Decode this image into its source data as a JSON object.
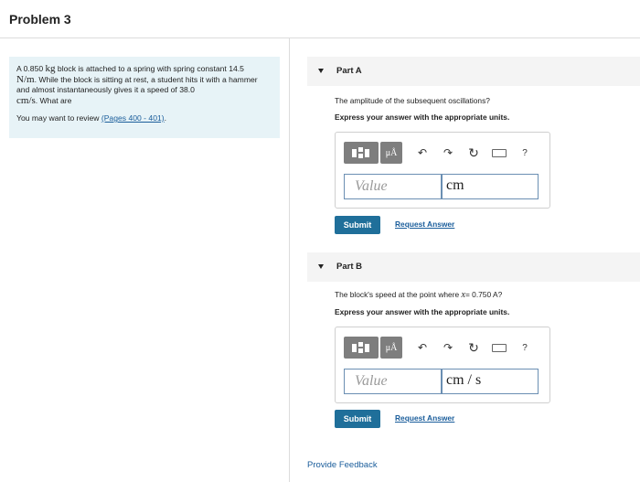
{
  "header": {
    "title": "Problem 3"
  },
  "problem": {
    "text_1": "A 0.850 ",
    "mass_unit": "kg",
    "text_2": " block is attached to a spring with spring constant 14.5",
    "k_unit": "N/m",
    "text_3": ". While the block is sitting at rest, a student hits it with a hammer and almost instantaneously gives it a speed of 38.0",
    "speed_unit": "cm/s",
    "text_4": ". What are",
    "review_prefix": "You may want to review ",
    "review_link": "(Pages 400 - 401)",
    "review_suffix": "."
  },
  "parts": [
    {
      "label": "Part A",
      "question_1": "The amplitude of the subsequent oscillations?",
      "question_var": "",
      "question_2": "",
      "instruction": "Express your answer with the appropriate units.",
      "value_placeholder": "Value",
      "unit_value": "cm",
      "submit_label": "Submit",
      "request_label": "Request Answer"
    },
    {
      "label": "Part B",
      "question_1": "The block's speed at the point where ",
      "question_var": "x",
      "question_2": "= 0.750 A?",
      "instruction": "Express your answer with the appropriate units.",
      "value_placeholder": "Value",
      "unit_value": "cm / s",
      "submit_label": "Submit",
      "request_label": "Request Answer"
    }
  ],
  "toolbar": {
    "unit_label": "μÅ",
    "undo_glyph": "↶",
    "redo_glyph": "↷",
    "reset_glyph": "↻",
    "help_glyph": "?"
  },
  "footer": {
    "feedback_label": "Provide Feedback"
  },
  "colors": {
    "accent": "#1f6f9a",
    "link": "#1a5d9b",
    "info_bg": "#e7f3f7"
  }
}
